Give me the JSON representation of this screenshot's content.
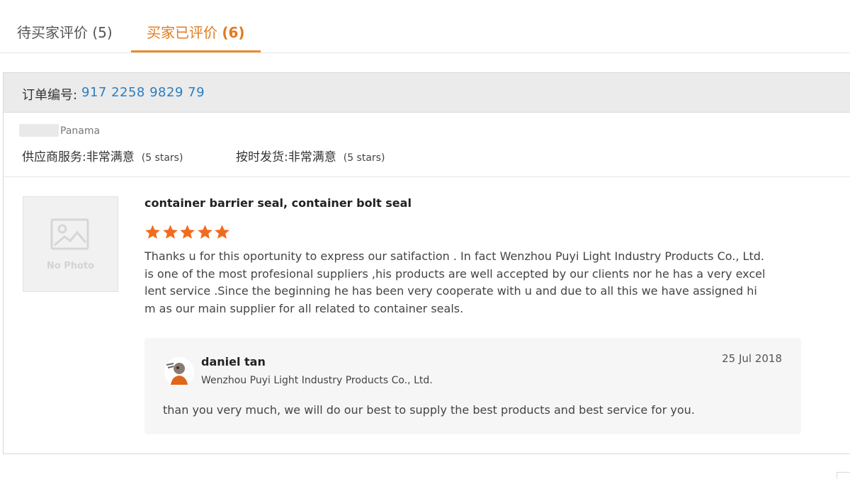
{
  "tabs": {
    "pending_label": "待买家评价",
    "pending_count": "(5)",
    "done_label": "买家已评价",
    "done_count": "(6)"
  },
  "order": {
    "label": "订单编号:",
    "number": "917 2258 9829 79"
  },
  "buyer": {
    "country": "Panama",
    "supplier_service_label": "供应商服务:",
    "supplier_service_value": "非常满意",
    "supplier_service_stars": "(5 stars)",
    "on_time_label": "按时发货:",
    "on_time_value": "非常满意",
    "on_time_stars": "(5 stars)"
  },
  "review": {
    "photo_placeholder": "No Photo",
    "product_title": "container barrier seal, container bolt seal",
    "rating": 5,
    "text": "Thanks u for this oportunity to express our satifaction . In fact Wenzhou Puyi Light Industry Products Co., Ltd. is one of the most profesional suppliers ,his products are well accepted by our clients nor he has a very excellent service .Since the beginning he has been very cooperate with u and due to all this we have assigned him as our main supplier for all related to container seals."
  },
  "reply": {
    "name": "daniel tan",
    "company": "Wenzhou Puyi Light Industry Products Co., Ltd.",
    "date": "25 Jul 2018",
    "text": "than you very much, we  will do our best to supply the best products and best  service for you."
  },
  "colors": {
    "accent": "#ef8a2d",
    "star": "#f26b1d",
    "link": "#2a7ec1"
  }
}
